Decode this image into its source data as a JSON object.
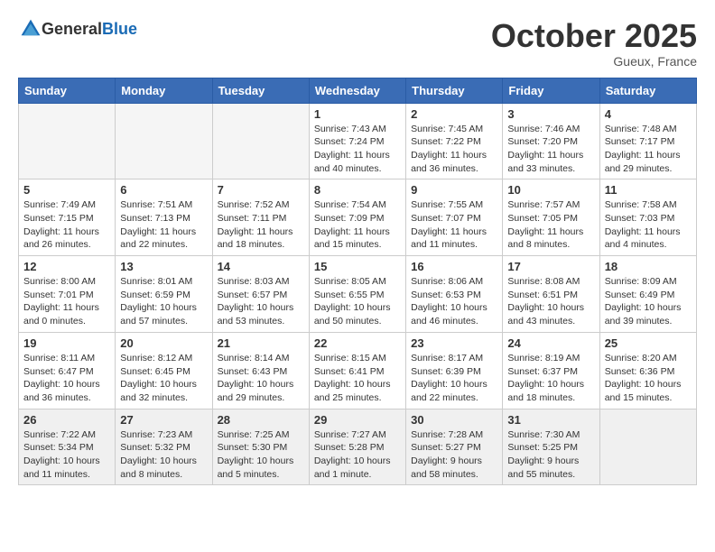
{
  "header": {
    "logo_general": "General",
    "logo_blue": "Blue",
    "month": "October 2025",
    "location": "Gueux, France"
  },
  "days_of_week": [
    "Sunday",
    "Monday",
    "Tuesday",
    "Wednesday",
    "Thursday",
    "Friday",
    "Saturday"
  ],
  "weeks": [
    [
      {
        "day": "",
        "info": ""
      },
      {
        "day": "",
        "info": ""
      },
      {
        "day": "",
        "info": ""
      },
      {
        "day": "1",
        "info": "Sunrise: 7:43 AM\nSunset: 7:24 PM\nDaylight: 11 hours and 40 minutes."
      },
      {
        "day": "2",
        "info": "Sunrise: 7:45 AM\nSunset: 7:22 PM\nDaylight: 11 hours and 36 minutes."
      },
      {
        "day": "3",
        "info": "Sunrise: 7:46 AM\nSunset: 7:20 PM\nDaylight: 11 hours and 33 minutes."
      },
      {
        "day": "4",
        "info": "Sunrise: 7:48 AM\nSunset: 7:17 PM\nDaylight: 11 hours and 29 minutes."
      }
    ],
    [
      {
        "day": "5",
        "info": "Sunrise: 7:49 AM\nSunset: 7:15 PM\nDaylight: 11 hours and 26 minutes."
      },
      {
        "day": "6",
        "info": "Sunrise: 7:51 AM\nSunset: 7:13 PM\nDaylight: 11 hours and 22 minutes."
      },
      {
        "day": "7",
        "info": "Sunrise: 7:52 AM\nSunset: 7:11 PM\nDaylight: 11 hours and 18 minutes."
      },
      {
        "day": "8",
        "info": "Sunrise: 7:54 AM\nSunset: 7:09 PM\nDaylight: 11 hours and 15 minutes."
      },
      {
        "day": "9",
        "info": "Sunrise: 7:55 AM\nSunset: 7:07 PM\nDaylight: 11 hours and 11 minutes."
      },
      {
        "day": "10",
        "info": "Sunrise: 7:57 AM\nSunset: 7:05 PM\nDaylight: 11 hours and 8 minutes."
      },
      {
        "day": "11",
        "info": "Sunrise: 7:58 AM\nSunset: 7:03 PM\nDaylight: 11 hours and 4 minutes."
      }
    ],
    [
      {
        "day": "12",
        "info": "Sunrise: 8:00 AM\nSunset: 7:01 PM\nDaylight: 11 hours and 0 minutes."
      },
      {
        "day": "13",
        "info": "Sunrise: 8:01 AM\nSunset: 6:59 PM\nDaylight: 10 hours and 57 minutes."
      },
      {
        "day": "14",
        "info": "Sunrise: 8:03 AM\nSunset: 6:57 PM\nDaylight: 10 hours and 53 minutes."
      },
      {
        "day": "15",
        "info": "Sunrise: 8:05 AM\nSunset: 6:55 PM\nDaylight: 10 hours and 50 minutes."
      },
      {
        "day": "16",
        "info": "Sunrise: 8:06 AM\nSunset: 6:53 PM\nDaylight: 10 hours and 46 minutes."
      },
      {
        "day": "17",
        "info": "Sunrise: 8:08 AM\nSunset: 6:51 PM\nDaylight: 10 hours and 43 minutes."
      },
      {
        "day": "18",
        "info": "Sunrise: 8:09 AM\nSunset: 6:49 PM\nDaylight: 10 hours and 39 minutes."
      }
    ],
    [
      {
        "day": "19",
        "info": "Sunrise: 8:11 AM\nSunset: 6:47 PM\nDaylight: 10 hours and 36 minutes."
      },
      {
        "day": "20",
        "info": "Sunrise: 8:12 AM\nSunset: 6:45 PM\nDaylight: 10 hours and 32 minutes."
      },
      {
        "day": "21",
        "info": "Sunrise: 8:14 AM\nSunset: 6:43 PM\nDaylight: 10 hours and 29 minutes."
      },
      {
        "day": "22",
        "info": "Sunrise: 8:15 AM\nSunset: 6:41 PM\nDaylight: 10 hours and 25 minutes."
      },
      {
        "day": "23",
        "info": "Sunrise: 8:17 AM\nSunset: 6:39 PM\nDaylight: 10 hours and 22 minutes."
      },
      {
        "day": "24",
        "info": "Sunrise: 8:19 AM\nSunset: 6:37 PM\nDaylight: 10 hours and 18 minutes."
      },
      {
        "day": "25",
        "info": "Sunrise: 8:20 AM\nSunset: 6:36 PM\nDaylight: 10 hours and 15 minutes."
      }
    ],
    [
      {
        "day": "26",
        "info": "Sunrise: 7:22 AM\nSunset: 5:34 PM\nDaylight: 10 hours and 11 minutes."
      },
      {
        "day": "27",
        "info": "Sunrise: 7:23 AM\nSunset: 5:32 PM\nDaylight: 10 hours and 8 minutes."
      },
      {
        "day": "28",
        "info": "Sunrise: 7:25 AM\nSunset: 5:30 PM\nDaylight: 10 hours and 5 minutes."
      },
      {
        "day": "29",
        "info": "Sunrise: 7:27 AM\nSunset: 5:28 PM\nDaylight: 10 hours and 1 minute."
      },
      {
        "day": "30",
        "info": "Sunrise: 7:28 AM\nSunset: 5:27 PM\nDaylight: 9 hours and 58 minutes."
      },
      {
        "day": "31",
        "info": "Sunrise: 7:30 AM\nSunset: 5:25 PM\nDaylight: 9 hours and 55 minutes."
      },
      {
        "day": "",
        "info": ""
      }
    ]
  ]
}
